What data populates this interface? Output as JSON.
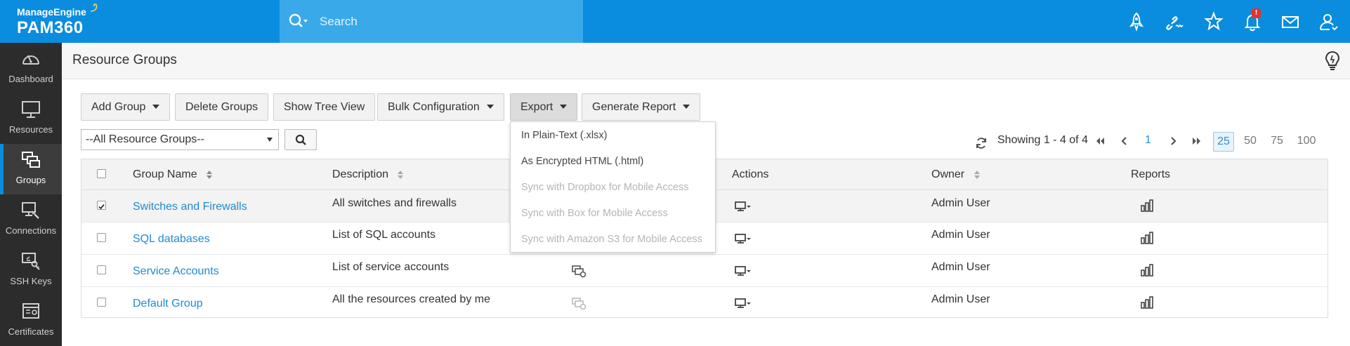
{
  "brand": {
    "company": "ManageEngine",
    "product": "PAM360"
  },
  "search": {
    "placeholder": "Search"
  },
  "notifications": {
    "badge": "!"
  },
  "sidebar": {
    "items": [
      {
        "label": "Dashboard",
        "icon": "dashboard-icon"
      },
      {
        "label": "Resources",
        "icon": "monitor-icon"
      },
      {
        "label": "Groups",
        "icon": "groups-icon",
        "active": true
      },
      {
        "label": "Connections",
        "icon": "connections-icon"
      },
      {
        "label": "SSH Keys",
        "icon": "ssh-key-icon"
      },
      {
        "label": "Certificates",
        "icon": "certificate-icon"
      }
    ]
  },
  "page": {
    "title": "Resource Groups"
  },
  "toolbar": {
    "add_group": "Add Group",
    "delete_groups": "Delete Groups",
    "show_tree_view": "Show Tree View",
    "bulk_configuration": "Bulk Configuration",
    "export": "Export",
    "generate_report": "Generate Report"
  },
  "filter": {
    "selected": "--All Resource Groups--"
  },
  "export_menu": {
    "items": [
      {
        "label": "In Plain-Text (.xlsx)",
        "enabled": true
      },
      {
        "label": "As Encrypted HTML (.html)",
        "enabled": true
      },
      {
        "label": "Sync with Dropbox for Mobile Access",
        "enabled": false
      },
      {
        "label": "Sync with Box for Mobile Access",
        "enabled": false
      },
      {
        "label": "Sync with Amazon S3 for Mobile Access",
        "enabled": false
      }
    ]
  },
  "pagination": {
    "showing": "Showing 1 - 4 of 4",
    "current_page": "1",
    "page_sizes": [
      "25",
      "50",
      "75",
      "100"
    ],
    "selected_size": "25"
  },
  "table": {
    "columns": {
      "group_name": "Group Name",
      "description": "Description",
      "actions": "Actions",
      "owner": "Owner",
      "reports": "Reports"
    },
    "rows": [
      {
        "name": "Switches and Firewalls",
        "description": "All switches and firewalls",
        "owner": "Admin User",
        "checked": true
      },
      {
        "name": "SQL databases",
        "description": "List of SQL accounts",
        "owner": "Admin User",
        "checked": false
      },
      {
        "name": "Service Accounts",
        "description": "List of service accounts",
        "owner": "Admin User",
        "checked": false
      },
      {
        "name": "Default Group",
        "description": "All the resources created by me",
        "owner": "Admin User",
        "checked": false
      }
    ]
  },
  "colors": {
    "brand_blue": "#0a8ddf",
    "search_blue": "#3aa9ea",
    "sidebar": "#2c2c2c",
    "link": "#1f8ad2"
  }
}
